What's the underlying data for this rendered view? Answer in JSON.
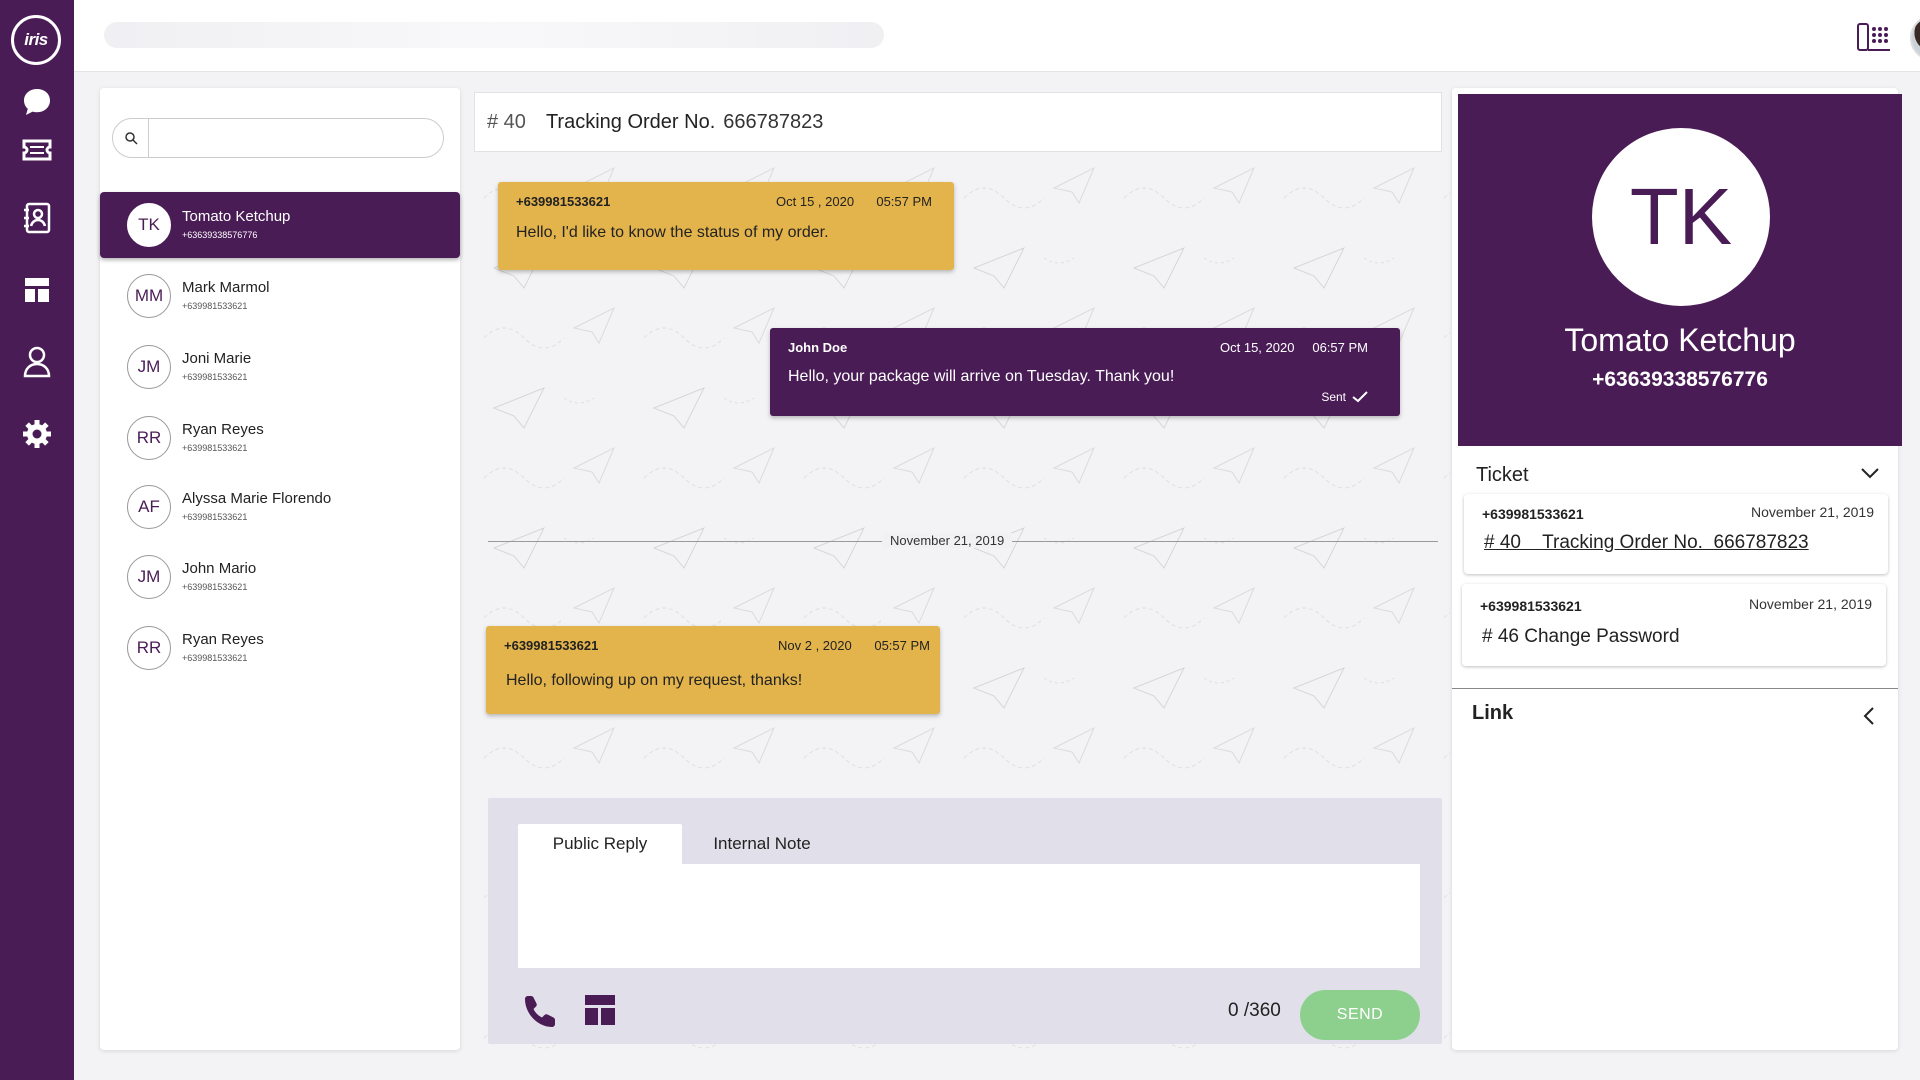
{
  "app": {
    "logo_text": "iris",
    "accent": "#4a1c56",
    "incoming_color": "#e4b44c",
    "send_color": "#8dd08e"
  },
  "rail": {
    "icons": [
      "chat-bubble-icon",
      "ticket-icon",
      "contacts-book-icon",
      "layout-icon",
      "user-icon",
      "gear-icon"
    ]
  },
  "search": {
    "placeholder": "",
    "value": ""
  },
  "contacts": [
    {
      "initials": "TK",
      "name": "Tomato Ketchup",
      "phone": "+63639338576776",
      "active": true
    },
    {
      "initials": "MM",
      "name": "Mark Marmol",
      "phone": "+639981533621"
    },
    {
      "initials": "JM",
      "name": "Joni Marie",
      "phone": "+639981533621"
    },
    {
      "initials": "RR",
      "name": "Ryan Reyes",
      "phone": "+639981533621"
    },
    {
      "initials": "AF",
      "name": "Alyssa Marie Florendo",
      "phone": "+639981533621"
    },
    {
      "initials": "JM",
      "name": "John Mario",
      "phone": "+639981533621"
    },
    {
      "initials": "RR",
      "name": "Ryan Reyes",
      "phone": "+639981533621"
    }
  ],
  "chat": {
    "ticket_number": "# 40",
    "ticket_title": "Tracking Order No.",
    "order_number": "666787823",
    "messages": [
      {
        "from": "+639981533621",
        "date": "Oct 15 , 2020",
        "time": "05:57 PM",
        "text": "Hello, I'd like to know the status of my order."
      },
      {
        "from": "John Doe",
        "date": "Oct 15, 2020",
        "time": "06:57 PM",
        "text": "Hello, your package will arrive on Tuesday. Thank you!",
        "status": "Sent"
      },
      {
        "from": "+639981533621",
        "date": "Nov 2 , 2020",
        "time": "05:57 PM",
        "text": "Hello, following up on my request, thanks!"
      }
    ],
    "divider_date": "November 21, 2019"
  },
  "reply": {
    "tabs": [
      "Public Reply",
      "Internal Note"
    ],
    "text": "",
    "counter": "0 /360",
    "send_label": "SEND"
  },
  "profile": {
    "initials": "TK",
    "name": "Tomato Ketchup",
    "phone": "+63639338576776"
  },
  "tickets_section": {
    "title": "Ticket",
    "items": [
      {
        "phone": "+639981533621",
        "date": "November 21, 2019",
        "title_num": "# 40",
        "title": "Tracking Order No.  666787823"
      },
      {
        "phone": "+639981533621",
        "date": "November 21, 2019",
        "title_num": "# 46",
        "title": "Change Password"
      }
    ]
  },
  "link_section": {
    "title": "Link"
  }
}
